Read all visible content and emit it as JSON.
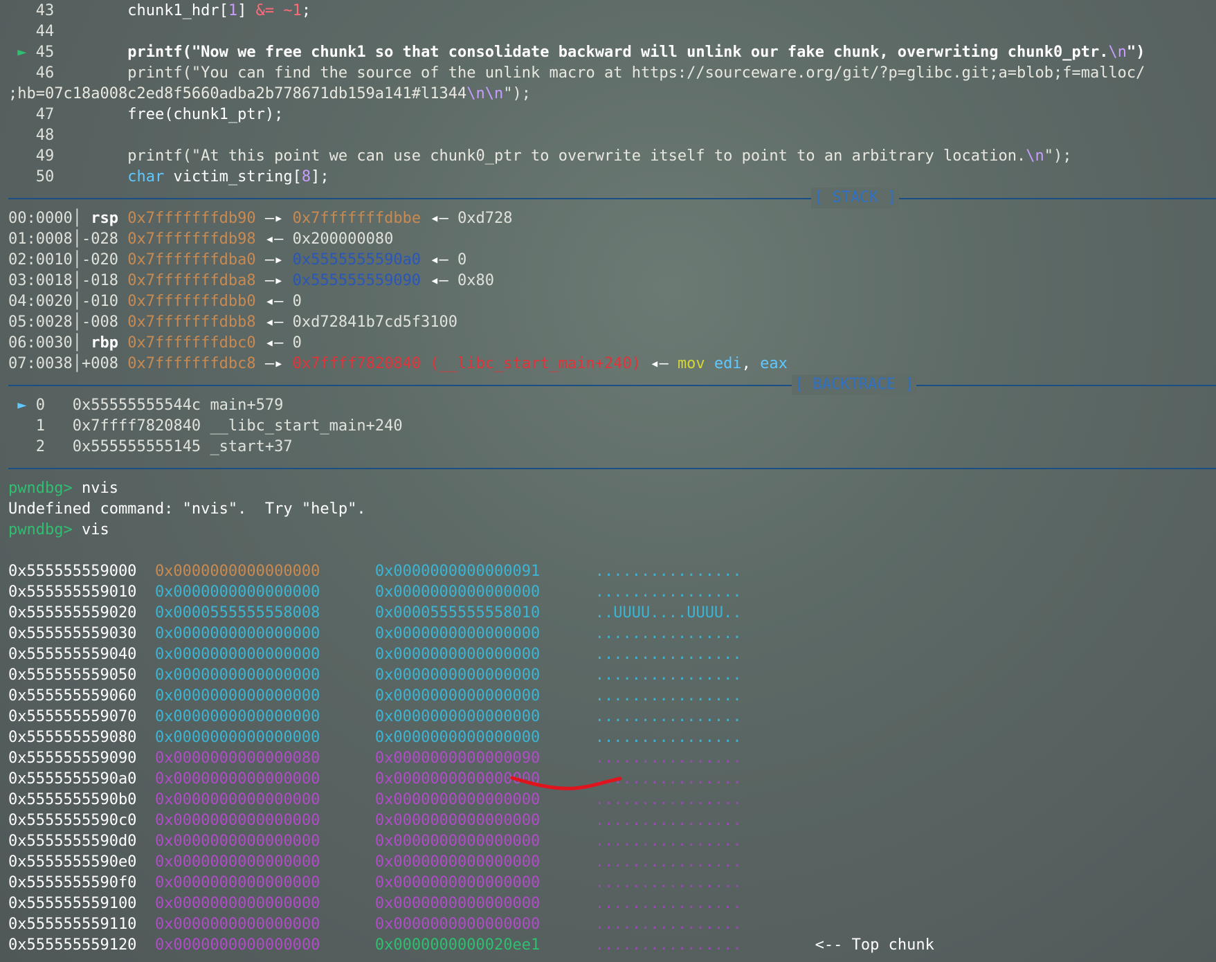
{
  "source": {
    "lines": [
      {
        "num": "43",
        "marker": "",
        "code": [
          {
            "t": "        chunk1_hdr[",
            "c": "code"
          },
          {
            "t": "1",
            "c": "num"
          },
          {
            "t": "] ",
            "c": "code"
          },
          {
            "t": "&=",
            "c": "op"
          },
          {
            "t": " ",
            "c": "code"
          },
          {
            "t": "~1",
            "c": "op"
          },
          {
            "t": ";",
            "c": "code"
          }
        ]
      },
      {
        "num": "44",
        "marker": "",
        "code": []
      },
      {
        "num": "45",
        "marker": "►",
        "code": [
          {
            "t": "        printf(",
            "c": "kw-fn"
          },
          {
            "t": "\"Now we free chunk1 so that consolidate backward will unlink our fake chunk, overwriting chunk0_ptr.",
            "c": "kw-fn"
          },
          {
            "t": "\\n",
            "c": "esc"
          },
          {
            "t": "\")",
            "c": "kw-fn"
          }
        ]
      },
      {
        "num": "46",
        "marker": "",
        "code": [
          {
            "t": "        printf(\"You can find the source of the unlink macro at https://sourceware.org/git/?p=glibc.git;a=blob;f=malloc/",
            "c": "str"
          }
        ]
      },
      {
        "num": "",
        "marker": "",
        "wrap": true,
        "code": [
          {
            "t": ";hb=07c18a008c2ed8f5660adba2b778671db159a141#l1344",
            "c": "str"
          },
          {
            "t": "\\n\\n",
            "c": "esc"
          },
          {
            "t": "\");",
            "c": "str"
          }
        ]
      },
      {
        "num": "47",
        "marker": "",
        "code": [
          {
            "t": "        free(chunk1_ptr);",
            "c": "code"
          }
        ]
      },
      {
        "num": "48",
        "marker": "",
        "code": []
      },
      {
        "num": "49",
        "marker": "",
        "code": [
          {
            "t": "        printf(\"At this point we can use chunk0_ptr to overwrite itself to point to an arbitrary location.",
            "c": "str"
          },
          {
            "t": "\\n",
            "c": "esc"
          },
          {
            "t": "\");",
            "c": "str"
          }
        ]
      },
      {
        "num": "50",
        "marker": "",
        "code": [
          {
            "t": "        ",
            "c": "code"
          },
          {
            "t": "char",
            "c": "type"
          },
          {
            "t": " victim_string[",
            "c": "code"
          },
          {
            "t": "8",
            "c": "num"
          },
          {
            "t": "];",
            "c": "code"
          }
        ]
      }
    ]
  },
  "stack": {
    "title": "[ STACK ]",
    "rows": [
      {
        "idx": "00:0000",
        "reg": "rsp",
        "off": "",
        "addr": "0x7fffffffdb90",
        "arrow": "—▸",
        "target": "0x7fffffffdbbe",
        "target_c": "addr-stack",
        "tail": [
          {
            "t": " ◂— ",
            "c": "arr"
          },
          {
            "t": "0xd728",
            "c": "val"
          }
        ]
      },
      {
        "idx": "01:0008",
        "reg": "",
        "off": "-028",
        "addr": "0x7fffffffdb98",
        "arrow": "◂—",
        "target": "0x200000080",
        "target_c": "val",
        "tail": []
      },
      {
        "idx": "02:0010",
        "reg": "",
        "off": "-020",
        "addr": "0x7fffffffdba0",
        "arrow": "—▸",
        "target": "0x5555555590a0",
        "target_c": "addr-heap",
        "tail": [
          {
            "t": " ◂— ",
            "c": "arr"
          },
          {
            "t": "0",
            "c": "val"
          }
        ]
      },
      {
        "idx": "03:0018",
        "reg": "",
        "off": "-018",
        "addr": "0x7fffffffdba8",
        "arrow": "—▸",
        "target": "0x555555559090",
        "target_c": "addr-heap",
        "tail": [
          {
            "t": " ◂— ",
            "c": "arr"
          },
          {
            "t": "0x80",
            "c": "val"
          }
        ]
      },
      {
        "idx": "04:0020",
        "reg": "",
        "off": "-010",
        "addr": "0x7fffffffdbb0",
        "arrow": "◂—",
        "target": "0",
        "target_c": "val",
        "tail": []
      },
      {
        "idx": "05:0028",
        "reg": "",
        "off": "-008",
        "addr": "0x7fffffffdbb8",
        "arrow": "◂—",
        "target": "0xd72841b7cd5f3100",
        "target_c": "val",
        "tail": []
      },
      {
        "idx": "06:0030",
        "reg": "rbp",
        "off": "",
        "addr": "0x7fffffffdbc0",
        "arrow": "◂—",
        "target": "0",
        "target_c": "val",
        "tail": []
      },
      {
        "idx": "07:0038",
        "reg": "",
        "off": "+008",
        "addr": "0x7fffffffdbc8",
        "arrow": "—▸",
        "target": "0x7ffff7820840 (__libc_start_main+240)",
        "target_c": "addr-code",
        "tail": [
          {
            "t": " ◂— ",
            "c": "arr"
          },
          {
            "t": "mov",
            "c": "instr"
          },
          {
            "t": " edi",
            "c": "reg2"
          },
          {
            "t": ", ",
            "c": "arr"
          },
          {
            "t": "eax",
            "c": "reg2"
          }
        ]
      }
    ]
  },
  "backtrace": {
    "title": "[ BACKTRACE ]",
    "frames": [
      {
        "marker": "►",
        "n": "0",
        "addr": "0x55555555544c",
        "sym": "main+579"
      },
      {
        "marker": "",
        "n": "1",
        "addr": "0x7ffff7820840",
        "sym": "__libc_start_main+240"
      },
      {
        "marker": "",
        "n": "2",
        "addr": "0x555555555145",
        "sym": "_start+37"
      }
    ]
  },
  "console": {
    "prompt": "pwndbg>",
    "cmd1": " nvis",
    "error": "Undefined command: \"nvis\".  Try \"help\".",
    "cmd2": " vis"
  },
  "heap": {
    "rows": [
      {
        "addr": "0x555555559000",
        "a": "0x0000000000000000",
        "ac": "c-brown",
        "b": "0x0000000000000091",
        "bc": "c-cyan",
        "d": "................",
        "dc": "dots-cyan",
        "note": ""
      },
      {
        "addr": "0x555555559010",
        "a": "0x0000000000000000",
        "ac": "c-cyan",
        "b": "0x0000000000000000",
        "bc": "c-cyan",
        "d": "................",
        "dc": "dots-cyan",
        "note": ""
      },
      {
        "addr": "0x555555559020",
        "a": "0x0000555555558008",
        "ac": "c-cyan",
        "b": "0x0000555555558010",
        "bc": "c-cyan",
        "d": "..UUUU....UUUU..",
        "dc": "dots-cyan",
        "note": ""
      },
      {
        "addr": "0x555555559030",
        "a": "0x0000000000000000",
        "ac": "c-cyan",
        "b": "0x0000000000000000",
        "bc": "c-cyan",
        "d": "................",
        "dc": "dots-cyan",
        "note": ""
      },
      {
        "addr": "0x555555559040",
        "a": "0x0000000000000000",
        "ac": "c-cyan",
        "b": "0x0000000000000000",
        "bc": "c-cyan",
        "d": "................",
        "dc": "dots-cyan",
        "note": ""
      },
      {
        "addr": "0x555555559050",
        "a": "0x0000000000000000",
        "ac": "c-cyan",
        "b": "0x0000000000000000",
        "bc": "c-cyan",
        "d": "................",
        "dc": "dots-cyan",
        "note": ""
      },
      {
        "addr": "0x555555559060",
        "a": "0x0000000000000000",
        "ac": "c-cyan",
        "b": "0x0000000000000000",
        "bc": "c-cyan",
        "d": "................",
        "dc": "dots-cyan",
        "note": ""
      },
      {
        "addr": "0x555555559070",
        "a": "0x0000000000000000",
        "ac": "c-cyan",
        "b": "0x0000000000000000",
        "bc": "c-cyan",
        "d": "................",
        "dc": "dots-cyan",
        "note": ""
      },
      {
        "addr": "0x555555559080",
        "a": "0x0000000000000000",
        "ac": "c-cyan",
        "b": "0x0000000000000000",
        "bc": "c-cyan",
        "d": "................",
        "dc": "dots-cyan",
        "note": ""
      },
      {
        "addr": "0x555555559090",
        "a": "0x0000000000000080",
        "ac": "c-purple",
        "b": "0x0000000000000090",
        "bc": "c-purple",
        "d": "................",
        "dc": "dots-purple",
        "note": ""
      },
      {
        "addr": "0x5555555590a0",
        "a": "0x0000000000000000",
        "ac": "c-purple",
        "b": "0x0000000000000000",
        "bc": "c-purple",
        "d": "................",
        "dc": "dots-purple",
        "note": ""
      },
      {
        "addr": "0x5555555590b0",
        "a": "0x0000000000000000",
        "ac": "c-purple",
        "b": "0x0000000000000000",
        "bc": "c-purple",
        "d": "................",
        "dc": "dots-purple",
        "note": ""
      },
      {
        "addr": "0x5555555590c0",
        "a": "0x0000000000000000",
        "ac": "c-purple",
        "b": "0x0000000000000000",
        "bc": "c-purple",
        "d": "................",
        "dc": "dots-purple",
        "note": ""
      },
      {
        "addr": "0x5555555590d0",
        "a": "0x0000000000000000",
        "ac": "c-purple",
        "b": "0x0000000000000000",
        "bc": "c-purple",
        "d": "................",
        "dc": "dots-purple",
        "note": ""
      },
      {
        "addr": "0x5555555590e0",
        "a": "0x0000000000000000",
        "ac": "c-purple",
        "b": "0x0000000000000000",
        "bc": "c-purple",
        "d": "................",
        "dc": "dots-purple",
        "note": ""
      },
      {
        "addr": "0x5555555590f0",
        "a": "0x0000000000000000",
        "ac": "c-purple",
        "b": "0x0000000000000000",
        "bc": "c-purple",
        "d": "................",
        "dc": "dots-purple",
        "note": ""
      },
      {
        "addr": "0x555555559100",
        "a": "0x0000000000000000",
        "ac": "c-purple",
        "b": "0x0000000000000000",
        "bc": "c-purple",
        "d": "................",
        "dc": "dots-purple",
        "note": ""
      },
      {
        "addr": "0x555555559110",
        "a": "0x0000000000000000",
        "ac": "c-purple",
        "b": "0x0000000000000000",
        "bc": "c-purple",
        "d": "................",
        "dc": "dots-purple",
        "note": ""
      },
      {
        "addr": "0x555555559120",
        "a": "0x0000000000000000",
        "ac": "c-purple",
        "b": "0x0000000000020ee1",
        "bc": "c-green",
        "d": "................",
        "dc": "dots-purple",
        "note": "<-- Top chunk"
      }
    ]
  },
  "colors": {
    "separator": "#1a4f86",
    "prompt": "#2fbf71",
    "annotation_red": "#e0141c"
  }
}
